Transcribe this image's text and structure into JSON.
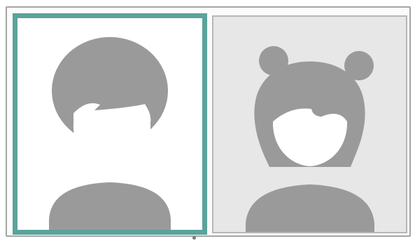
{
  "avatar_picker": {
    "options": [
      {
        "icon": "male-avatar-icon",
        "selected": true
      },
      {
        "icon": "female-avatar-icon",
        "selected": false
      }
    ],
    "colors": {
      "selection_border": "#5aa39b",
      "silhouette": "#9a9a9a",
      "face": "#ffffff",
      "unselected_background": "#e7e7e7",
      "selected_background": "#ffffff",
      "indicator_dot": "#7a7a7a"
    }
  }
}
